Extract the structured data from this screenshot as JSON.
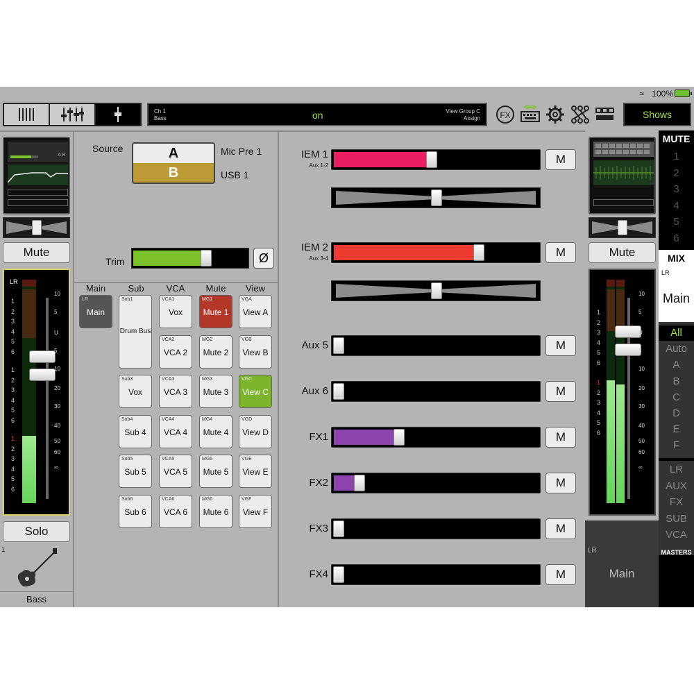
{
  "status": {
    "wifi": "wifi-icon",
    "battery_text": "100%"
  },
  "toolbar": {
    "view_buttons": [
      "mixer-view-icon",
      "channel-fader-icon",
      "single-fader-icon"
    ],
    "ch_line1": "Ch 1",
    "ch_line2": "Bass",
    "ch_state": "on",
    "right_line1": "View Group C",
    "right_line2": "Assign",
    "icons": [
      "fx-icon",
      "keyboard-icon",
      "gear-icon",
      "routing-icon",
      "layout-icon"
    ],
    "fx_label": "FX",
    "shows_label": "Shows"
  },
  "left_strip": {
    "mini_ab": "A B",
    "mute_label": "Mute",
    "fader_label": "LR",
    "scale": [
      "10",
      "5",
      "U",
      "5",
      "10",
      "20",
      "30",
      "40",
      "50",
      "60",
      "∞"
    ],
    "nums_top": [
      "1",
      "2",
      "3",
      "4",
      "5",
      "6"
    ],
    "nums_mid": [
      "1",
      "2",
      "3",
      "4",
      "5",
      "6"
    ],
    "nums_bot": [
      "1",
      "2",
      "3",
      "4",
      "5",
      "6"
    ],
    "solo_label": "Solo",
    "channel_number": "1",
    "channel_name": "Bass",
    "level_pct": 30
  },
  "source": {
    "label": "Source",
    "a": "A",
    "b": "B",
    "a_name": "Mic Pre 1",
    "b_name": "USB 1"
  },
  "trim": {
    "label": "Trim",
    "phase": "Ø",
    "level_pct": 63
  },
  "groups": {
    "headers": [
      "Main",
      "Sub",
      "VCA",
      "Mute",
      "View"
    ],
    "main": {
      "tag": "LR",
      "name": "Main"
    },
    "sub": [
      {
        "tag": "Sub1",
        "name": "Drum Bus"
      },
      {
        "tag": "Sub3",
        "name": "Vox"
      },
      {
        "tag": "Sub4",
        "name": "Sub 4"
      },
      {
        "tag": "Sub5",
        "name": "Sub 5"
      },
      {
        "tag": "Sub6",
        "name": "Sub 6"
      }
    ],
    "vca": [
      {
        "tag": "VCA1",
        "name": "Vox"
      },
      {
        "tag": "VCA2",
        "name": "VCA 2"
      },
      {
        "tag": "VCA3",
        "name": "VCA 3"
      },
      {
        "tag": "VCA4",
        "name": "VCA 4"
      },
      {
        "tag": "VCA5",
        "name": "VCA 5"
      },
      {
        "tag": "VCA6",
        "name": "VCA 6"
      }
    ],
    "mute": [
      {
        "tag": "MG1",
        "name": "Mute 1"
      },
      {
        "tag": "MG2",
        "name": "Mute 2"
      },
      {
        "tag": "MG3",
        "name": "Mute 3"
      },
      {
        "tag": "MG4",
        "name": "Mute 4"
      },
      {
        "tag": "MG5",
        "name": "Mute 5"
      },
      {
        "tag": "MG6",
        "name": "Mute 6"
      }
    ],
    "view": [
      {
        "tag": "VGA",
        "name": "View A"
      },
      {
        "tag": "VGB",
        "name": "View B"
      },
      {
        "tag": "VGC",
        "name": "View C"
      },
      {
        "tag": "VGD",
        "name": "View D"
      },
      {
        "tag": "VGE",
        "name": "View E"
      },
      {
        "tag": "VGF",
        "name": "View F"
      }
    ]
  },
  "sends": [
    {
      "name": "IEM 1",
      "sub": "Aux 1-2",
      "level": 0.48,
      "color": "#e91e63",
      "pan": true,
      "mute": "M"
    },
    {
      "name": "IEM 2",
      "sub": "Aux 3-4",
      "level": 0.71,
      "color": "#ee3b2f",
      "pan": true,
      "mute": "M"
    },
    {
      "name": "Aux 5",
      "sub": "",
      "level": 0.0,
      "color": "",
      "pan": false,
      "mute": "M"
    },
    {
      "name": "Aux 6",
      "sub": "",
      "level": 0.0,
      "color": "",
      "pan": false,
      "mute": "M"
    },
    {
      "name": "FX1",
      "sub": "",
      "level": 0.32,
      "color": "#8e44ad",
      "pan": false,
      "mute": "M"
    },
    {
      "name": "FX2",
      "sub": "",
      "level": 0.13,
      "color": "#8e44ad",
      "pan": false,
      "mute": "M"
    },
    {
      "name": "FX3",
      "sub": "",
      "level": 0.0,
      "color": "",
      "pan": false,
      "mute": "M"
    },
    {
      "name": "FX4",
      "sub": "",
      "level": 0.0,
      "color": "",
      "pan": false,
      "mute": "M"
    }
  ],
  "right_strip": {
    "mute_label": "Mute",
    "fader_label": "LR",
    "nums_top": [
      "1",
      "2",
      "3",
      "4",
      "5",
      "6"
    ],
    "nums_bot": [
      "1",
      "2",
      "3",
      "4",
      "5",
      "6"
    ],
    "bottom_tag": "LR",
    "bottom_name": "Main",
    "level_pct": 55
  },
  "mute_mix": {
    "mute_header": "MUTE",
    "mute_nums": [
      "1",
      "2",
      "3",
      "4",
      "5",
      "6"
    ],
    "mix_header": "MIX",
    "mix_tag": "LR",
    "mix_name": "Main",
    "view_items": [
      "All",
      "Auto",
      "A",
      "B",
      "C",
      "D",
      "E",
      "F"
    ],
    "layer_items": [
      "LR",
      "AUX",
      "FX",
      "SUB",
      "VCA"
    ],
    "masters_label": "MASTERS"
  }
}
